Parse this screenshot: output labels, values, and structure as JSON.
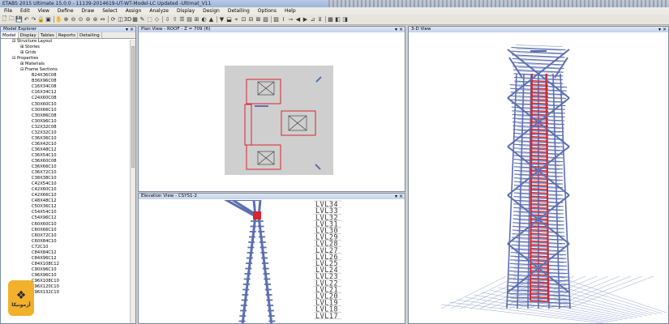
{
  "window": {
    "title": "ETABS 2015 Ultimate 15.0.0 - 11139-2014619-UT-WT-Model-LC Updated -Ultimat_V11"
  },
  "menu": [
    "File",
    "Edit",
    "View",
    "Define",
    "Draw",
    "Select",
    "Assign",
    "Analyze",
    "Display",
    "Design",
    "Detailing",
    "Options",
    "Help"
  ],
  "model_explorer": {
    "title": "Model Explorer",
    "tabs": [
      "Model",
      "Display",
      "Tables",
      "Reports",
      "Detailing"
    ],
    "tree_top": [
      "Structure Layout",
      "Stories",
      "Grids",
      "Properties",
      "Materials",
      "Frame Sections"
    ],
    "frame_sections": [
      "B24X36C08",
      "B36X96C08",
      "C16X34C08",
      "C16X34C12",
      "C24X60C08",
      "C30X60C10",
      "C30X66C10",
      "C30X86C08",
      "C30X96C10",
      "C32X32C08",
      "C32X32C10",
      "C36X36C10",
      "C36X42C10",
      "C36X48C12",
      "C36X54C10",
      "C36X60C08",
      "C36X66C10",
      "C36X72C10",
      "C38X38C10",
      "C42X54C10",
      "C42X60C10",
      "C42X66C10",
      "C48X48C12",
      "C50X36C12",
      "C54X54C10",
      "C54X96C12",
      "C60X60C10",
      "C60X66C10",
      "C60X72C10",
      "C60X84C10",
      "C72C10",
      "C84X84C12",
      "C84X96C12",
      "C84X108C12",
      "C90X96C10",
      "C96X96C10",
      "C96X108C10",
      "C96X120C10",
      "C96X132C10"
    ],
    "controls": "▾ ×"
  },
  "plan_view": {
    "title": "Plan View - ROOF - Z = 709 (ft)",
    "controls": "▾ ×"
  },
  "elevation_view": {
    "title": "Elevation View - CSYS1-2",
    "controls": "▾ ×",
    "levels": [
      "LVL35",
      "LVL34",
      "LVL33",
      "LVL32",
      "LVL31",
      "LVL30",
      "LVL29",
      "LVL28",
      "LVL27",
      "LVL26",
      "LVL25",
      "LVL24",
      "LVL23",
      "LVL22",
      "LVL21",
      "LVL20",
      "LVL19",
      "LVL18",
      "LVL17"
    ]
  },
  "view_3d": {
    "title": "3-D View",
    "controls": "▾ ×"
  },
  "logo": {
    "text": "آزمونیکا",
    "color": "#f2b12c"
  },
  "colors": {
    "frame_blue": "#5b6fb0",
    "frame_red": "#d8252b",
    "panel_border": "#7a8aa8"
  }
}
